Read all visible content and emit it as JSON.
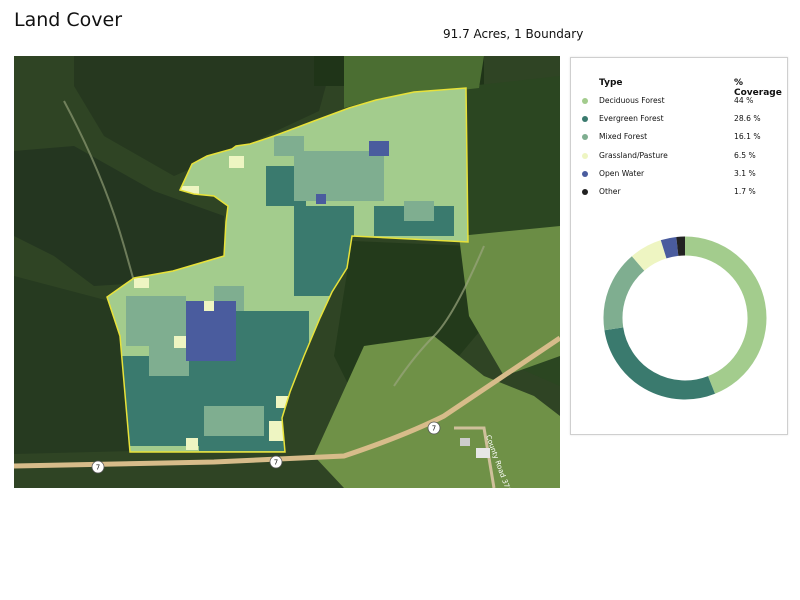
{
  "page": {
    "title": "Land Cover",
    "summary": "91.7 Acres, 1 Boundary"
  },
  "map": {
    "road_shield": "7",
    "road_label": "County Road 373"
  },
  "legend": {
    "header_type": "Type",
    "header_coverage": "% Coverage",
    "items": [
      {
        "label": "Deciduous Forest",
        "value": "44 %",
        "percent": 44,
        "color": "#a3cc8d"
      },
      {
        "label": "Evergreen Forest",
        "value": "28.6 %",
        "percent": 28.6,
        "color": "#3a7a6e"
      },
      {
        "label": "Mixed Forest",
        "value": "16.1 %",
        "percent": 16.1,
        "color": "#7fae90"
      },
      {
        "label": "Grassland/Pasture",
        "value": "6.5 %",
        "percent": 6.5,
        "color": "#eef5c2"
      },
      {
        "label": "Open Water",
        "value": "3.1 %",
        "percent": 3.1,
        "color": "#4a5c9e"
      },
      {
        "label": "Other",
        "value": "1.7 %",
        "percent": 1.7,
        "color": "#222222"
      }
    ]
  }
}
